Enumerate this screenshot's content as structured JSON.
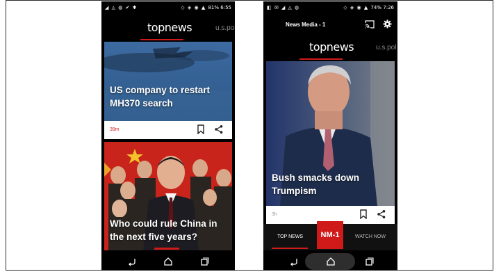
{
  "left": {
    "status": {
      "time": "6:55",
      "battery": "81%"
    },
    "brand": "topnews",
    "next_tab": "u.s.pol",
    "cards": [
      {
        "headline": "US company to restart MH370 search",
        "time": "39m"
      },
      {
        "headline": "Who could rule China in the next five years?"
      }
    ]
  },
  "right": {
    "status": {
      "time": "7:26",
      "battery": "74%"
    },
    "app_title": "News Media - 1",
    "brand": "topnews",
    "next_tab": "u.s.pol",
    "card": {
      "headline": "Bush smacks down Trumpism",
      "time": "3h"
    },
    "bottom_tabs": {
      "left": "TOP NEWS",
      "center": "NM-1",
      "right": "WATCH NOW"
    }
  },
  "colors": {
    "accent": "#d01a1a",
    "bg": "#000000"
  }
}
